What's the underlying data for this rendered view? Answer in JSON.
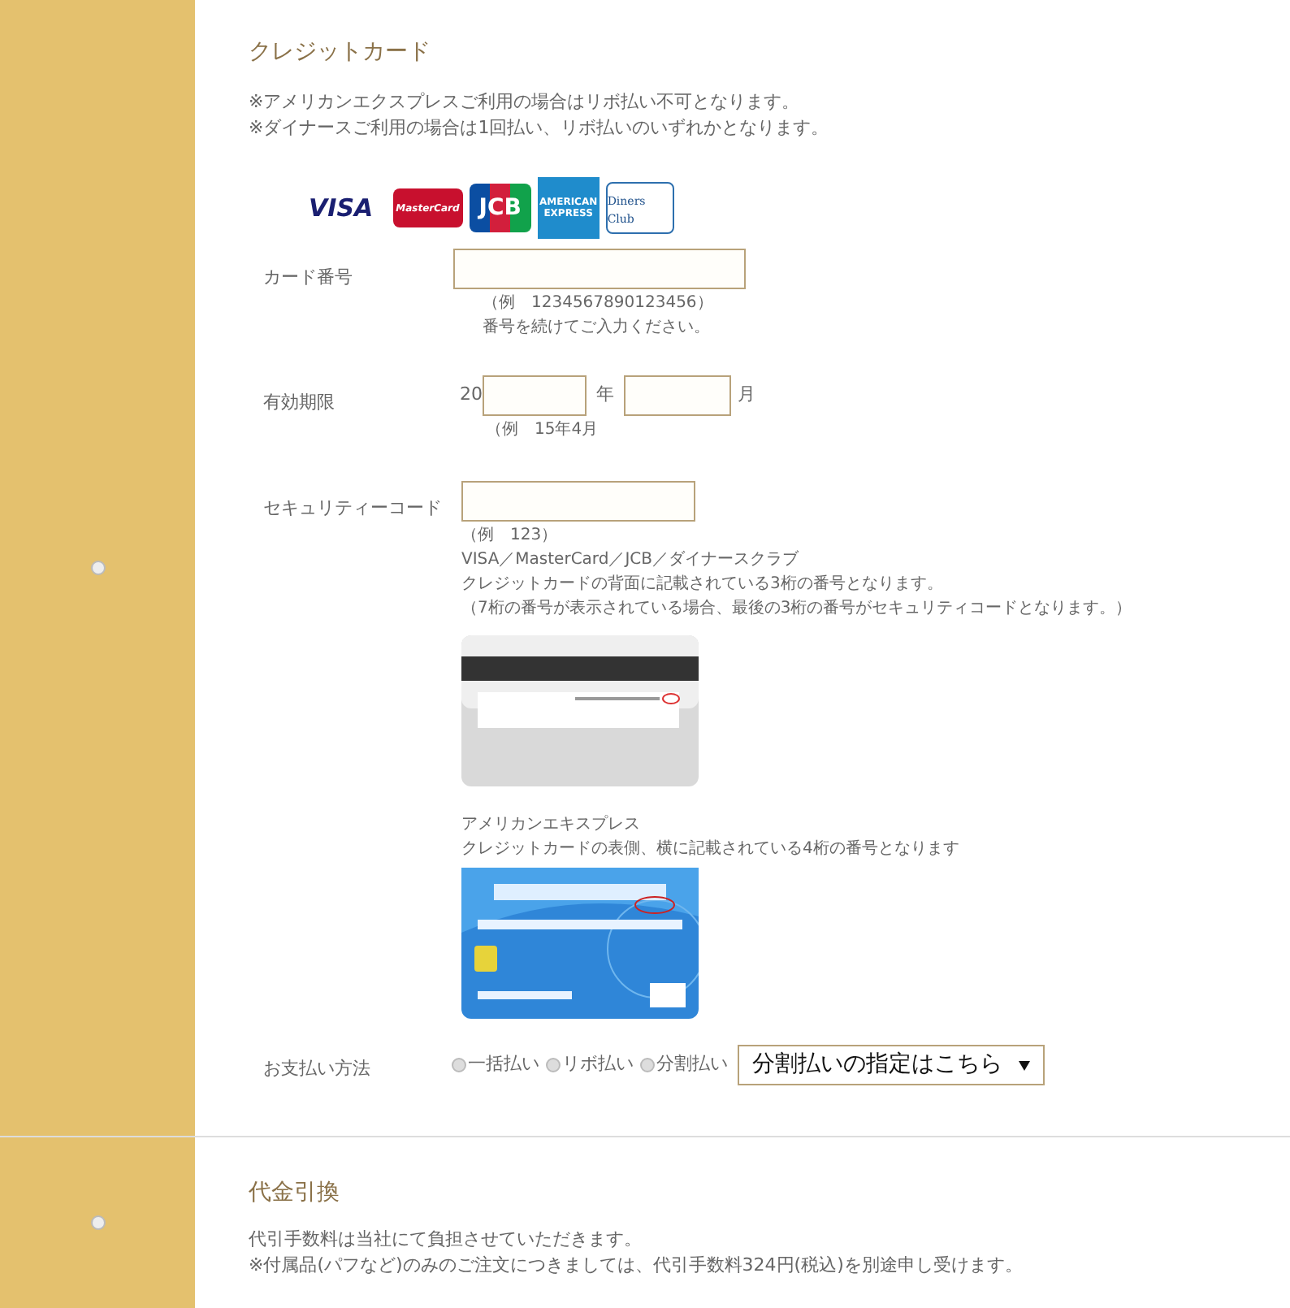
{
  "credit_card": {
    "selected": false,
    "title": "クレジットカード",
    "notes": [
      "※アメリカンエクスプレスご利用の場合はリボ払い不可となります。",
      "※ダイナースご利用の場合は1回払い、リボ払いのいずれかとなります。"
    ],
    "brands": [
      {
        "kind": "visa",
        "label": "VISA"
      },
      {
        "kind": "master",
        "label": "MasterCard"
      },
      {
        "kind": "jcb",
        "label": "JCB"
      },
      {
        "kind": "amex",
        "label": "AMERICAN EXPRESS"
      },
      {
        "kind": "diners",
        "label": "Diners Club"
      }
    ],
    "card_number": {
      "label": "カード番号",
      "hints": [
        "（例　1234567890123456）",
        "番号を続けてご入力ください。"
      ]
    },
    "expiry": {
      "label": "有効期限",
      "prefix": "20",
      "year_unit": "年",
      "month_unit": "月",
      "hint": "（例　15年4月"
    },
    "security_code": {
      "label": "セキュリティーコード",
      "hints": [
        "（例　123）",
        "VISA／MasterCard／JCB／ダイナースクラブ",
        "クレジットカードの背面に記載されている3桁の番号となります。",
        "（7桁の番号が表示されている場合、最後の3桁の番号がセキュリティコードとなります。）"
      ],
      "amex_hints": [
        "アメリカンエキスプレス",
        "クレジットカードの表側、横に記載されている4桁の番号となります"
      ]
    },
    "payment_method": {
      "label": "お支払い方法",
      "options": [
        {
          "label": "一括払い",
          "selected": false
        },
        {
          "label": "リボ払い",
          "selected": false
        },
        {
          "label": "分割払い",
          "selected": false
        }
      ],
      "installment_select": "分割払いの指定はこちら"
    }
  },
  "cod": {
    "selected": false,
    "title": "代金引換",
    "notes": [
      "代引手数料は当社にて負担させていただきます。",
      "※付属品(パフなど)のみのご注文につきましては、代引手数料324円(税込)を別途申し受けます。"
    ]
  }
}
